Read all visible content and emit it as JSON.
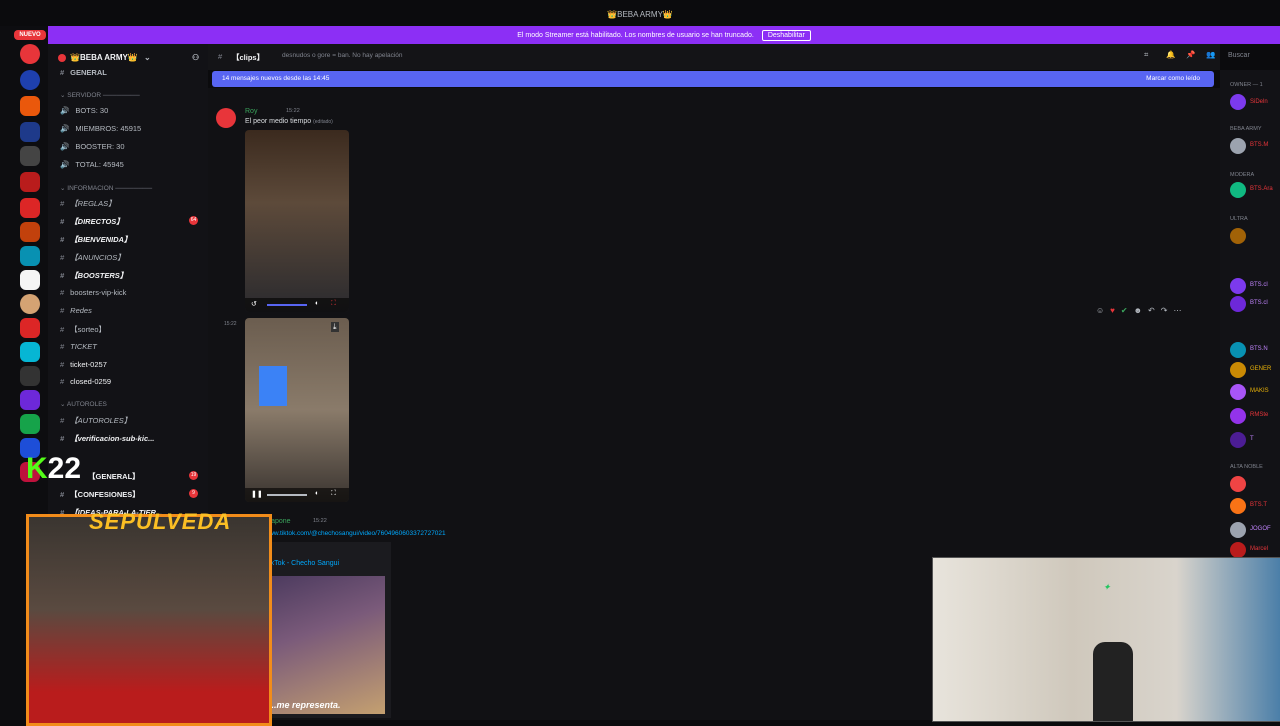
{
  "window": {
    "title": "👑BEBA ARMY👑"
  },
  "banner": {
    "text": "El modo Streamer está habilitado. Los nombres de usuario se han truncado.",
    "button": "Deshabilitar"
  },
  "rail": {
    "new_label": "NUEVO"
  },
  "server": {
    "name": "👑BEBA ARMY👑"
  },
  "sidebar": {
    "top_channel": "GENERAL",
    "categories": [
      {
        "label": "SERVIDOR"
      },
      {
        "label": "INFORMACION"
      },
      {
        "label": "AUTOROLES"
      }
    ],
    "stats": [
      "BOTS: 30",
      "MIEMBROS: 45915",
      "BOOSTER: 30",
      "TOTAL: 45945"
    ],
    "info_channels": [
      {
        "label": "【REGLAS】"
      },
      {
        "label": "【DIRECTOS】",
        "badge": "64"
      },
      {
        "label": "【BIENVENIDA】"
      },
      {
        "label": "【ANUNCIOS】"
      },
      {
        "label": "【BOOSTERS】"
      },
      {
        "label": "boosters-vip-kick"
      },
      {
        "label": "Redes"
      },
      {
        "label": "【sorteo】"
      },
      {
        "label": "TICKET"
      },
      {
        "label": "ticket-0257"
      },
      {
        "label": "closed-0259"
      }
    ],
    "autorol_channels": [
      {
        "label": "【AUTOROLES】"
      },
      {
        "label": "【verificacion-sub-kic..."
      },
      {
        "label": "【GENERAL】",
        "badge": "19"
      },
      {
        "label": "【CONFESIONES】",
        "badge": "9"
      },
      {
        "label": "【IDEAS-PARA-LA-TIER..."
      }
    ]
  },
  "chat_header": {
    "channel": "【clips】",
    "topic": "desnudos o gore = ban. No hay apelación"
  },
  "new_messages": {
    "text": "14 mensajes nuevos desde las 14:45",
    "action": "Marcar como leído"
  },
  "messages": [
    {
      "author": "Roy",
      "time": "15:22",
      "text": "El peor medio tiempo",
      "edited": "(editado)"
    },
    {
      "time": "15:22"
    },
    {
      "author": "Enzzo Kapone",
      "time": "15:22",
      "link": "https://www.tiktok.com/@chechosangui/video/7604960603372727021",
      "embed_title": "TikTok - Checho Sangui",
      "embed_caption": "...me representa."
    }
  ],
  "members": {
    "categories": [
      "OWNER — 1",
      "BEBA ARMY",
      "MODERA",
      "ULTRA",
      "ALTA NOBLE"
    ],
    "names": [
      "SiDeln",
      "BTS.M",
      "BTS.Ara",
      "BTS.cl",
      "BTS.cl",
      "BTS.N",
      "GENER",
      "MAKIS",
      "RMSte",
      "T",
      "BTS.T",
      "JOGOF",
      "Marcel"
    ]
  },
  "overlay": {
    "counter": "22",
    "streamer_tag": "SEPULVEDA"
  },
  "colors": {
    "accent": "#8c2ff5",
    "blurple": "#5865f2",
    "badge": "#e8353a",
    "green": "#3ba55d",
    "cam_frame": "#f28c1a"
  }
}
